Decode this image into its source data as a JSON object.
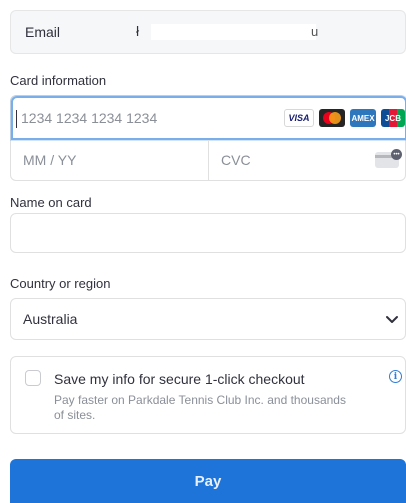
{
  "email": {
    "label": "Email",
    "value_start": "ł",
    "value_end": "u"
  },
  "card": {
    "section_label": "Card information",
    "number_placeholder": "1234 1234 1234 1234",
    "expiry_placeholder": "MM / YY",
    "cvc_placeholder": "CVC",
    "brands": [
      "VISA",
      "Mastercard",
      "American Express",
      "JCB"
    ],
    "brand_text": {
      "visa": "VISA",
      "amex": "AMEX",
      "jcb": "JCB"
    }
  },
  "name": {
    "section_label": "Name on card",
    "value": ""
  },
  "country": {
    "section_label": "Country or region",
    "selected": "Australia"
  },
  "save": {
    "title": "Save my info for secure 1-click checkout",
    "description": "Pay faster on Parkdale Tennis Club Inc. and thousands of sites.",
    "checked": false
  },
  "pay": {
    "label": "Pay",
    "color": "#1e74d8"
  },
  "colors": {
    "focus_border": "#7aaee8",
    "info": "#2f7dd7"
  }
}
